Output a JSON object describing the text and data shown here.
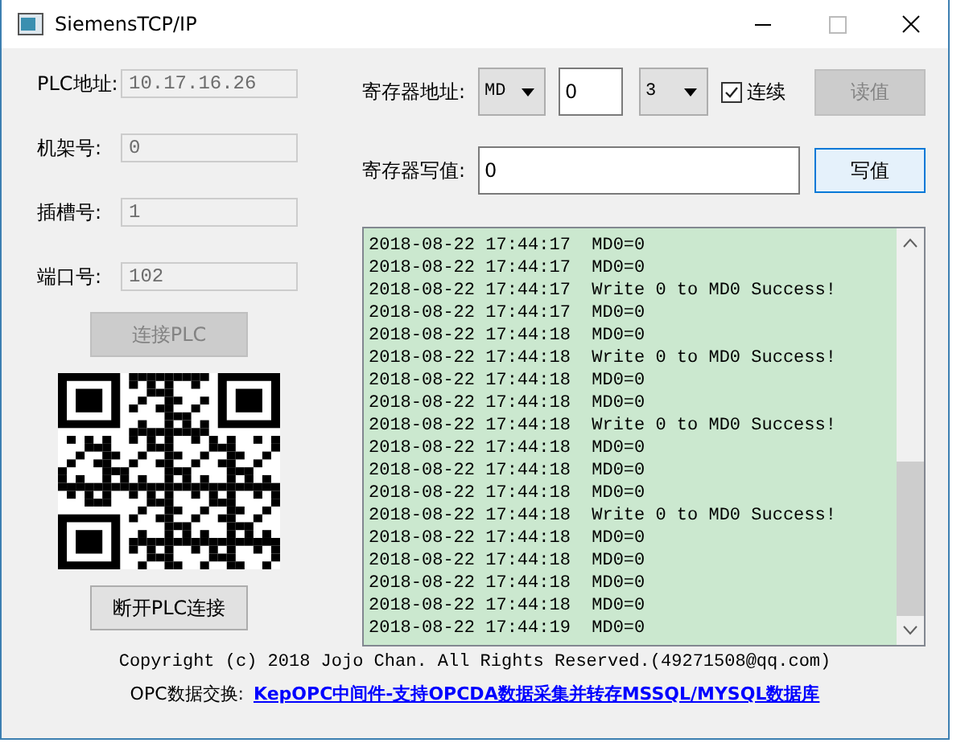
{
  "window": {
    "title": "SiemensTCP/IP"
  },
  "connection_fields": [
    {
      "label": "PLC地址:",
      "value": "10.17.16.26",
      "disabled": true
    },
    {
      "label": "机架号:",
      "value": "0",
      "disabled": true
    },
    {
      "label": "插槽号:",
      "value": "1",
      "disabled": true
    },
    {
      "label": "端口号:",
      "value": "102",
      "disabled": true
    }
  ],
  "connect_button": {
    "label": "连接PLC",
    "disabled": true
  },
  "disconnect_button": {
    "label": "断开PLC连接",
    "disabled": false
  },
  "register": {
    "label": "寄存器地址:",
    "area": "MD",
    "address": "0",
    "length": "3",
    "continuous": {
      "label": "连续",
      "checked": true
    },
    "read_button": {
      "label": "读值",
      "disabled": true
    }
  },
  "write": {
    "label": "寄存器写值:",
    "value": "0",
    "button": {
      "label": "写值",
      "focused": true
    }
  },
  "log": {
    "lines": [
      "2018-08-22 17:44:17  MD0=0",
      "2018-08-22 17:44:17  MD0=0",
      "2018-08-22 17:44:17  Write 0 to MD0 Success!",
      "2018-08-22 17:44:17  MD0=0",
      "2018-08-22 17:44:18  MD0=0",
      "2018-08-22 17:44:18  Write 0 to MD0 Success!",
      "2018-08-22 17:44:18  MD0=0",
      "2018-08-22 17:44:18  MD0=0",
      "2018-08-22 17:44:18  Write 0 to MD0 Success!",
      "2018-08-22 17:44:18  MD0=0",
      "2018-08-22 17:44:18  MD0=0",
      "2018-08-22 17:44:18  MD0=0",
      "2018-08-22 17:44:18  Write 0 to MD0 Success!",
      "2018-08-22 17:44:18  MD0=0",
      "2018-08-22 17:44:18  MD0=0",
      "2018-08-22 17:44:18  MD0=0",
      "2018-08-22 17:44:18  MD0=0",
      "2018-08-22 17:44:19  MD0=0"
    ]
  },
  "footer": {
    "copyright": "Copyright (c) 2018 Jojo Chan. All Rights Reserved.(49271508@qq.com)",
    "opc_label": "OPC数据交换:",
    "opc_link": "KepOPC中间件-支持OPCDA数据采集并转存MSSQL/MYSQL数据库"
  }
}
